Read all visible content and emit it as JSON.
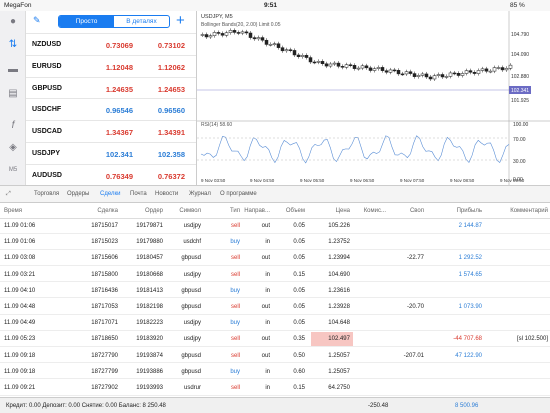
{
  "status": {
    "carrier": "MegaFon",
    "time": "9:51",
    "battery": "85 %"
  },
  "toolbar": {
    "simple_label": "Просто",
    "detailed_label": "В деталях",
    "add_label": "+"
  },
  "quotes": [
    {
      "symbol": "NZDUSD",
      "bid": "0.73069",
      "ask": "0.73102",
      "bid_color": "red",
      "ask_color": "red"
    },
    {
      "symbol": "EURUSD",
      "bid": "1.12048",
      "ask": "1.12062",
      "bid_color": "red",
      "ask_color": "red"
    },
    {
      "symbol": "GBPUSD",
      "bid": "1.24635",
      "ask": "1.24653",
      "bid_color": "red",
      "ask_color": "red"
    },
    {
      "symbol": "USDCHF",
      "bid": "0.96546",
      "ask": "0.96560",
      "bid_color": "blue",
      "ask_color": "blue"
    },
    {
      "symbol": "USDCAD",
      "bid": "1.34367",
      "ask": "1.34391",
      "bid_color": "red",
      "ask_color": "red"
    },
    {
      "symbol": "USDJPY",
      "bid": "102.341",
      "ask": "102.358",
      "bid_color": "blue",
      "ask_color": "blue"
    },
    {
      "symbol": "AUDUSD",
      "bid": "0.76349",
      "ask": "0.76372",
      "bid_color": "red",
      "ask_color": "red"
    }
  ],
  "chart": {
    "title": "USDJPY, M5",
    "subtitle": "Bollinger Bands(20, 2.00) Limit 0.05",
    "price_labels": [
      "104.790",
      "104.090",
      "103.220",
      "102.880",
      "102.341",
      "101.925"
    ],
    "rsi_label": "RSI(14) 58.60",
    "rsi_levels": [
      "100.00",
      "70.00",
      "30.00",
      "0.00"
    ],
    "time_labels": [
      "9 Nov 03:50",
      "9 Nov 04:50",
      "9 Nov 05:50",
      "9 Nov 06:50",
      "9 Nov 07:50",
      "9 Nov 08:50",
      "9 Nov 09:50"
    ],
    "current_price": "102.341"
  },
  "tabs": [
    "Торговля",
    "Ордеры",
    "Сделки",
    "Почта",
    "Новости",
    "Журнал",
    "О программе"
  ],
  "active_tab": "Сделки",
  "columns": [
    "Время",
    "Сделка",
    "Ордер",
    "Символ",
    "Тип",
    "Направ...",
    "Объем",
    "Цена",
    "Комис...",
    "Своп",
    "Прибыль",
    "Комментарий"
  ],
  "deals": [
    [
      "11.09 01:06",
      "18715017",
      "19179871",
      "usdjpy",
      "sell",
      "out",
      "0.05",
      "105.226",
      "",
      "",
      "2 144.87",
      ""
    ],
    [
      "11.09 01:06",
      "18715023",
      "19179880",
      "usdchf",
      "buy",
      "in",
      "0.05",
      "1.23752",
      "",
      "",
      "",
      ""
    ],
    [
      "11.09 03:08",
      "18715606",
      "19180457",
      "gbpusd",
      "sell",
      "out",
      "0.05",
      "1.23994",
      "",
      "-22.77",
      "1 292.52",
      ""
    ],
    [
      "11.09 03:21",
      "18715800",
      "19180668",
      "usdjpy",
      "sell",
      "in",
      "0.15",
      "104.690",
      "",
      "",
      "1 574.65",
      ""
    ],
    [
      "11.09 04:10",
      "18716436",
      "19181413",
      "gbpusd",
      "buy",
      "in",
      "0.05",
      "1.23616",
      "",
      "",
      "",
      ""
    ],
    [
      "11.09 04:48",
      "18717053",
      "19182198",
      "gbpusd",
      "sell",
      "out",
      "0.05",
      "1.23928",
      "",
      "-20.70",
      "1 073.90",
      ""
    ],
    [
      "11.09 04:49",
      "18717071",
      "19182223",
      "usdjpy",
      "buy",
      "in",
      "0.05",
      "104.648",
      "",
      "",
      "",
      ""
    ],
    [
      "11.09 05:23",
      "18718650",
      "19183920",
      "usdjpy",
      "sell",
      "out",
      "0.35",
      "102.497",
      "",
      "",
      "-44 707.68",
      "[sl 102.500]"
    ],
    [
      "11.09 09:18",
      "18727790",
      "19193874",
      "gbpusd",
      "sell",
      "out",
      "0.50",
      "1.25057",
      "",
      "-207.01",
      "47 122.90",
      ""
    ],
    [
      "11.09 09:18",
      "18727799",
      "19193886",
      "gbpusd",
      "buy",
      "in",
      "0.60",
      "1.25057",
      "",
      "",
      "",
      ""
    ],
    [
      "11.09 09:21",
      "18727902",
      "19193993",
      "usdrur",
      "sell",
      "in",
      "0.15",
      "64.2750",
      "",
      "",
      "",
      ""
    ]
  ],
  "footer": {
    "summary": "Кредит: 0.00 Депозит: 0.00 Снятие: 0.00 Баланс: 8 250.48",
    "swap_total": "-250.48",
    "profit_total": "8 500.96"
  },
  "colors": {
    "accent": "#1a7cf0",
    "sell": "#d93a2f",
    "buy": "#2b7dd6",
    "loss_bg": "#f7c6c2"
  }
}
